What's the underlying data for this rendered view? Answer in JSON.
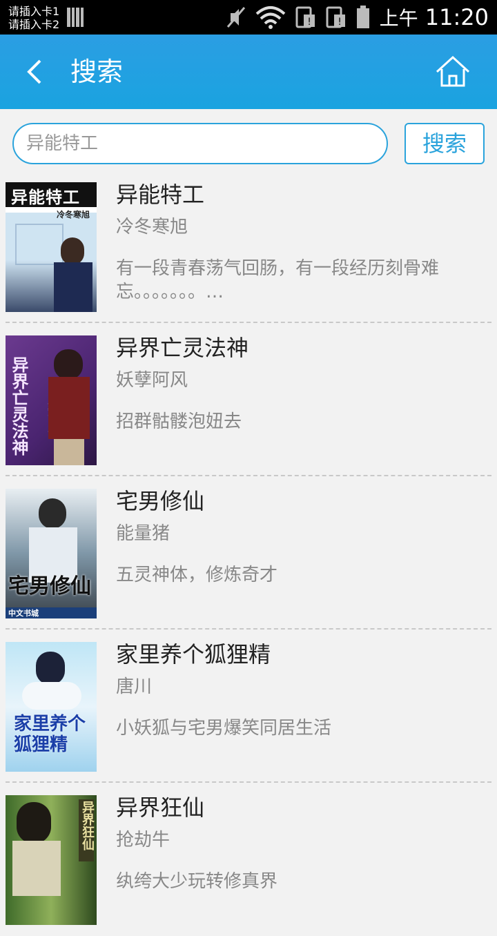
{
  "status": {
    "sim1": "请插入卡1",
    "sim2": "请插入卡2",
    "time_prefix": "上午",
    "time": "11:20"
  },
  "header": {
    "title": "搜索"
  },
  "search": {
    "value": "异能特工",
    "button_label": "搜索"
  },
  "books": [
    {
      "title": "异能特工",
      "author": "冷冬寒旭",
      "desc": "有一段青春荡气回肠，有一段经历刻骨难忘。。。。。。。…",
      "cover_text": "异能特工",
      "cover_sub": "冷冬寒旭"
    },
    {
      "title": "异界亡灵法神",
      "author": "妖孽阿风",
      "desc": "招群骷髅泡妞去",
      "cover_text": "异界亡灵法神",
      "cover_sub": "妖孽阿风"
    },
    {
      "title": "宅男修仙",
      "author": "能量猪",
      "desc": "五灵神体，修炼奇才",
      "cover_text": "宅男修仙",
      "cover_sub": "中文书城"
    },
    {
      "title": "家里养个狐狸精",
      "author": "唐川",
      "desc": "小妖狐与宅男爆笑同居生活",
      "cover_text": "家里养个狐狸精",
      "cover_sub": ""
    },
    {
      "title": "异界狂仙",
      "author": "抢劫牛",
      "desc": "纨绔大少玩转修真界",
      "cover_text": "异界狂仙",
      "cover_sub": ""
    }
  ]
}
